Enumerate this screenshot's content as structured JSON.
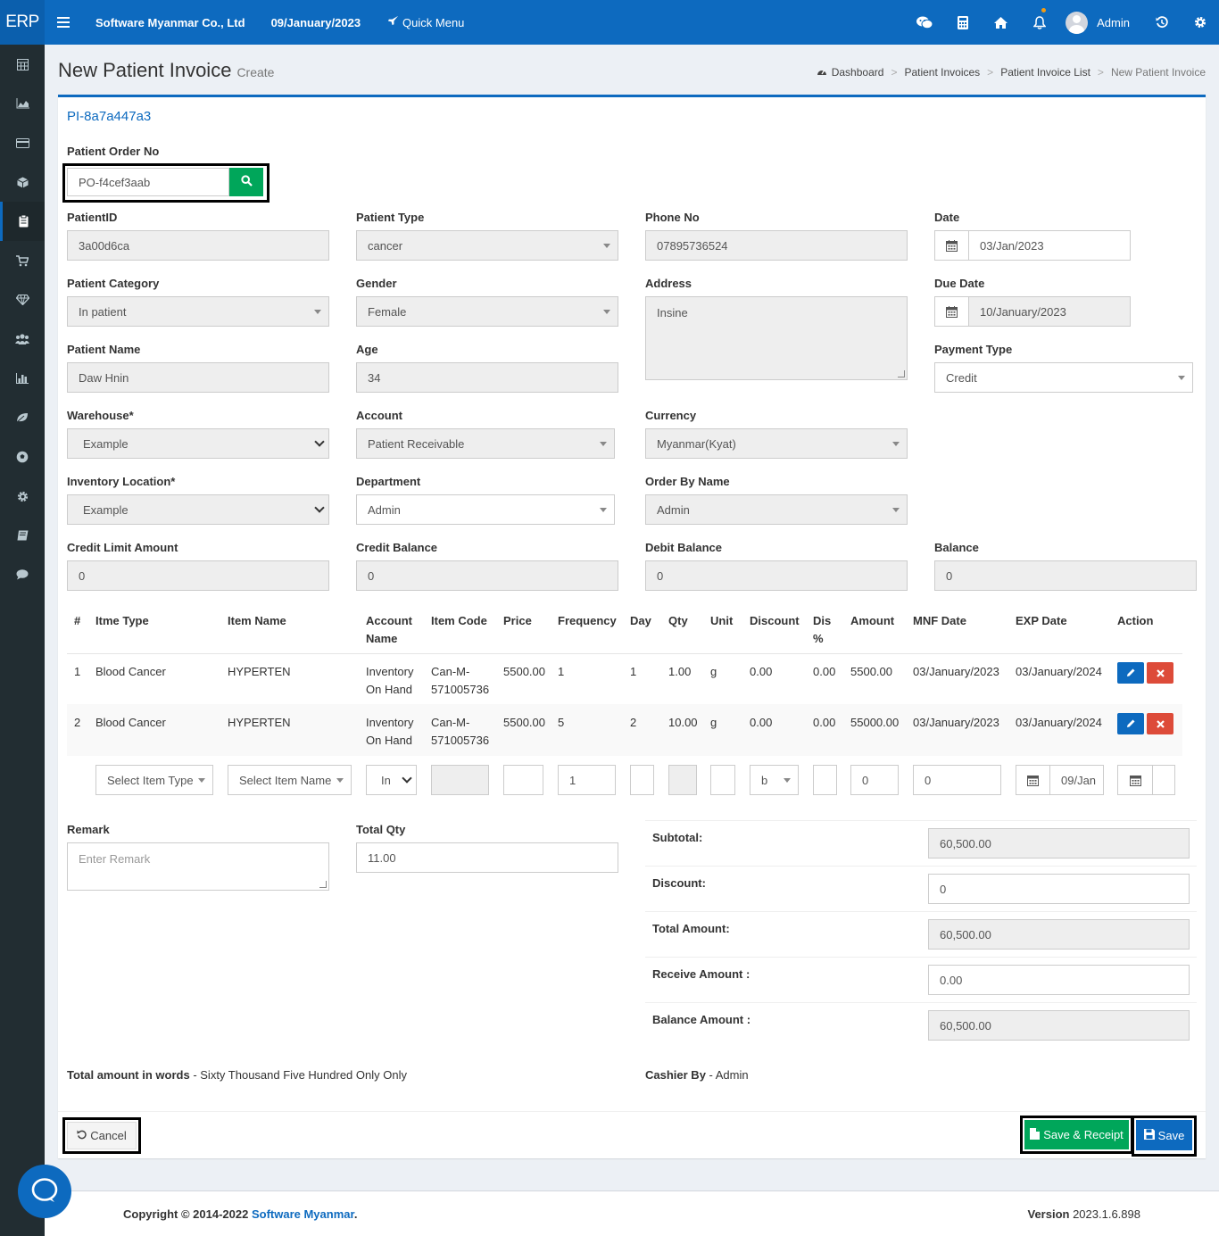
{
  "topbar": {
    "logo": "ERP",
    "company": "Software Myanmar Co., Ltd",
    "date": "09/January/2023",
    "quick_menu": "Quick Menu",
    "user": "Admin"
  },
  "sidebar": {
    "items": [
      "calculator-icon",
      "area-chart-icon",
      "credit-card-icon",
      "cube-icon",
      "clipboard-icon",
      "cart-icon",
      "diamond-icon",
      "users-icon",
      "bar-chart-icon",
      "leaf-icon",
      "soccer-icon",
      "gear-icon",
      "book-icon",
      "comment-icon"
    ]
  },
  "header": {
    "title": "New Patient Invoice",
    "subtitle": "Create",
    "breadcrumb": [
      "Dashboard",
      "Patient Invoices",
      "Patient Invoice List",
      "New Patient Invoice"
    ]
  },
  "form": {
    "invoice_no": "PI-8a7a447a3",
    "patient_order_no_label": "Patient Order No",
    "patient_order_no": "PO-f4cef3aab",
    "patient_id_label": "PatientID",
    "patient_id": "3a00d6ca",
    "patient_type_label": "Patient Type",
    "patient_type": "cancer",
    "phone_label": "Phone No",
    "phone": "07895736524",
    "date_label": "Date",
    "date": "03/Jan/2023",
    "patient_category_label": "Patient Category",
    "patient_category": "In patient",
    "gender_label": "Gender",
    "gender": "Female",
    "address_label": "Address",
    "address": "Insine",
    "due_date_label": "Due Date",
    "due_date": "10/January/2023",
    "patient_name_label": "Patient Name",
    "patient_name": "Daw Hnin",
    "age_label": "Age",
    "age": "34",
    "payment_type_label": "Payment Type",
    "payment_type": "Credit",
    "warehouse_label": "Warehouse*",
    "warehouse": "Example",
    "account_label": "Account",
    "account": "Patient Receivable",
    "currency_label": "Currency",
    "currency": "Myanmar(Kyat)",
    "inventory_location_label": "Inventory Location*",
    "inventory_location": "Example",
    "department_label": "Department",
    "department": "Admin",
    "order_by_label": "Order By Name",
    "order_by": "Admin",
    "credit_limit_label": "Credit Limit Amount",
    "credit_limit": "0",
    "credit_balance_label": "Credit Balance",
    "credit_balance": "0",
    "debit_balance_label": "Debit Balance",
    "debit_balance": "0",
    "balance_label": "Balance",
    "balance": "0"
  },
  "table": {
    "headers": {
      "no": "#",
      "item_type": "Itme Type",
      "item_name": "Item Name",
      "account_name": "Account Name",
      "item_code": "Item Code",
      "price": "Price",
      "frequency": "Frequency",
      "day": "Day",
      "qty": "Qty",
      "unit": "Unit",
      "discount": "Discount",
      "dis_pct": "Dis %",
      "amount": "Amount",
      "mnf_date": "MNF Date",
      "exp_date": "EXP Date",
      "action": "Action"
    },
    "rows": [
      {
        "no": "1",
        "item_type": "Blood Cancer",
        "item_name": "HYPERTEN",
        "account_name": "Inventory On Hand",
        "item_code": "Can-M-571005736",
        "price": "5500.00",
        "frequency": "1",
        "day": "1",
        "qty": "1.00",
        "unit": "g",
        "discount": "0.00",
        "dis_pct": "0.00",
        "amount": "5500.00",
        "mnf_date": "03/January/2023",
        "exp_date": "03/January/2024"
      },
      {
        "no": "2",
        "item_type": "Blood Cancer",
        "item_name": "HYPERTEN",
        "account_name": "Inventory On Hand",
        "item_code": "Can-M-571005736",
        "price": "5500.00",
        "frequency": "5",
        "day": "2",
        "qty": "10.00",
        "unit": "g",
        "discount": "0.00",
        "dis_pct": "0.00",
        "amount": "55000.00",
        "mnf_date": "03/January/2023",
        "exp_date": "03/January/2024"
      }
    ],
    "entry": {
      "item_type_placeholder": "Select Item Type",
      "item_name_placeholder": "Select Item Name",
      "account_short": "In",
      "frequency": "1",
      "unit_short": "b",
      "amount": "0",
      "mnf": "0",
      "exp_date": "09/Jan"
    }
  },
  "bottom": {
    "remark_label": "Remark",
    "remark_placeholder": "Enter Remark",
    "total_qty_label": "Total Qty",
    "total_qty": "11.00",
    "subtotal_label": "Subtotal:",
    "subtotal": "60,500.00",
    "discount_label": "Discount:",
    "discount": "0",
    "total_amount_label": "Total Amount:",
    "total_amount": "60,500.00",
    "receive_label": "Receive Amount :",
    "receive": "0.00",
    "balance_label": "Balance Amount :",
    "balance": "60,500.00",
    "words_label": "Total amount in words",
    "words": " - Sixty Thousand Five Hundred Only Only",
    "cashier_label": "Cashier By",
    "cashier": " - Admin"
  },
  "actions": {
    "cancel": "Cancel",
    "save_receipt": "Save & Receipt",
    "save": "Save"
  },
  "footer": {
    "copyright": "Copyright © 2014-2022 ",
    "company_link": "Software Myanmar",
    "dot": ".",
    "version_label": "Version",
    "version": " 2023.1.6.898"
  },
  "colors": {
    "primary": "#0d6abf",
    "success": "#00a65a",
    "danger": "#dd4b39",
    "sidebar": "#222d32"
  }
}
